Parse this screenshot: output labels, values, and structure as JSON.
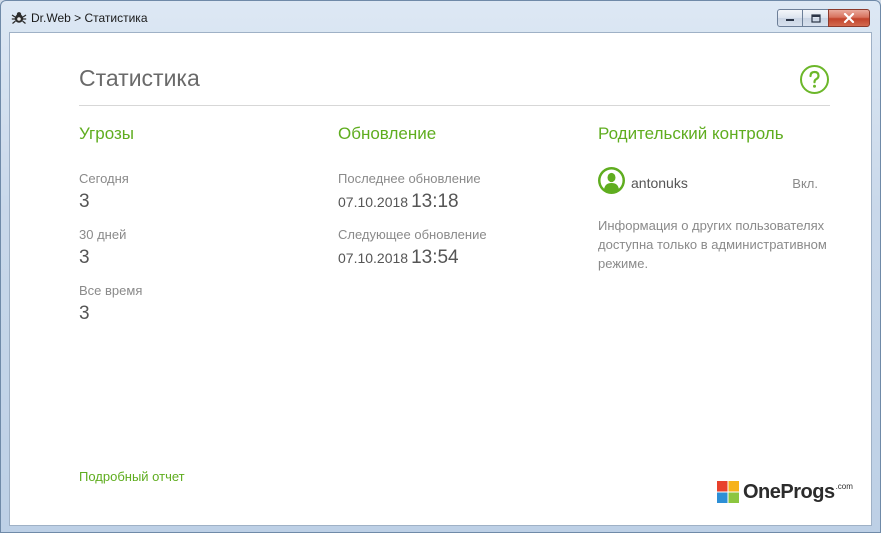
{
  "window": {
    "title": "Dr.Web > Статистика"
  },
  "page": {
    "title": "Статистика"
  },
  "threats": {
    "heading": "Угрозы",
    "today_label": "Сегодня",
    "today_value": "3",
    "days30_label": "30 дней",
    "days30_value": "3",
    "alltime_label": "Все время",
    "alltime_value": "3"
  },
  "update": {
    "heading": "Обновление",
    "last_label": "Последнее обновление",
    "last_date": "07.10.2018",
    "last_time": "13:18",
    "next_label": "Следующее обновление",
    "next_date": "07.10.2018",
    "next_time": "13:54"
  },
  "parental": {
    "heading": "Родительский контроль",
    "user_name": "antonuks",
    "user_state": "Вкл.",
    "info": "Информация о других пользователях доступна только в административном режиме."
  },
  "footer": {
    "report_link": "Подробный отчет",
    "logo_text": "OneProgs",
    "logo_sup": ".com"
  },
  "colors": {
    "accent": "#5fad1f",
    "text": "#555555",
    "muted": "#8a8a8a"
  },
  "icons": {
    "app": "drweb-spider-icon",
    "help": "help-icon",
    "avatar": "user-avatar-icon",
    "minimize": "minimize-icon",
    "maximize": "maximize-icon",
    "close": "close-icon"
  }
}
